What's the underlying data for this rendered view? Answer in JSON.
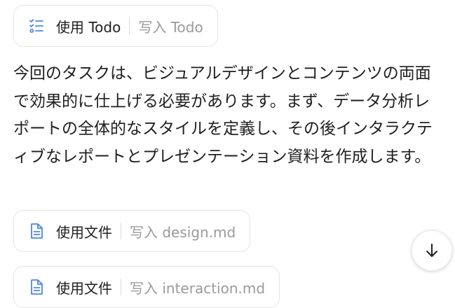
{
  "todo_chip": {
    "tool_label": "使用 Todo",
    "target_label": "写入 Todo"
  },
  "message": {
    "text": "今回のタスクは、ビジュアルデザインとコンテンツの両面で効果的に仕上げる必要があります。まず、データ分析レポートの全体的なスタイルを定義し、その後インタラクティブなレポートとプレゼンテーション資料を作成します。"
  },
  "file_chips": [
    {
      "tool_label": "使用文件",
      "target_label": "写入 design.md"
    },
    {
      "tool_label": "使用文件",
      "target_label": "写入 interaction.md"
    }
  ],
  "icons": {
    "todo": "checklist-icon",
    "file": "document-icon",
    "scroll": "arrow-down-icon"
  },
  "colors": {
    "accent": "#4a86e8",
    "muted_text": "#9a9a9a",
    "border": "#e3e3e3"
  }
}
